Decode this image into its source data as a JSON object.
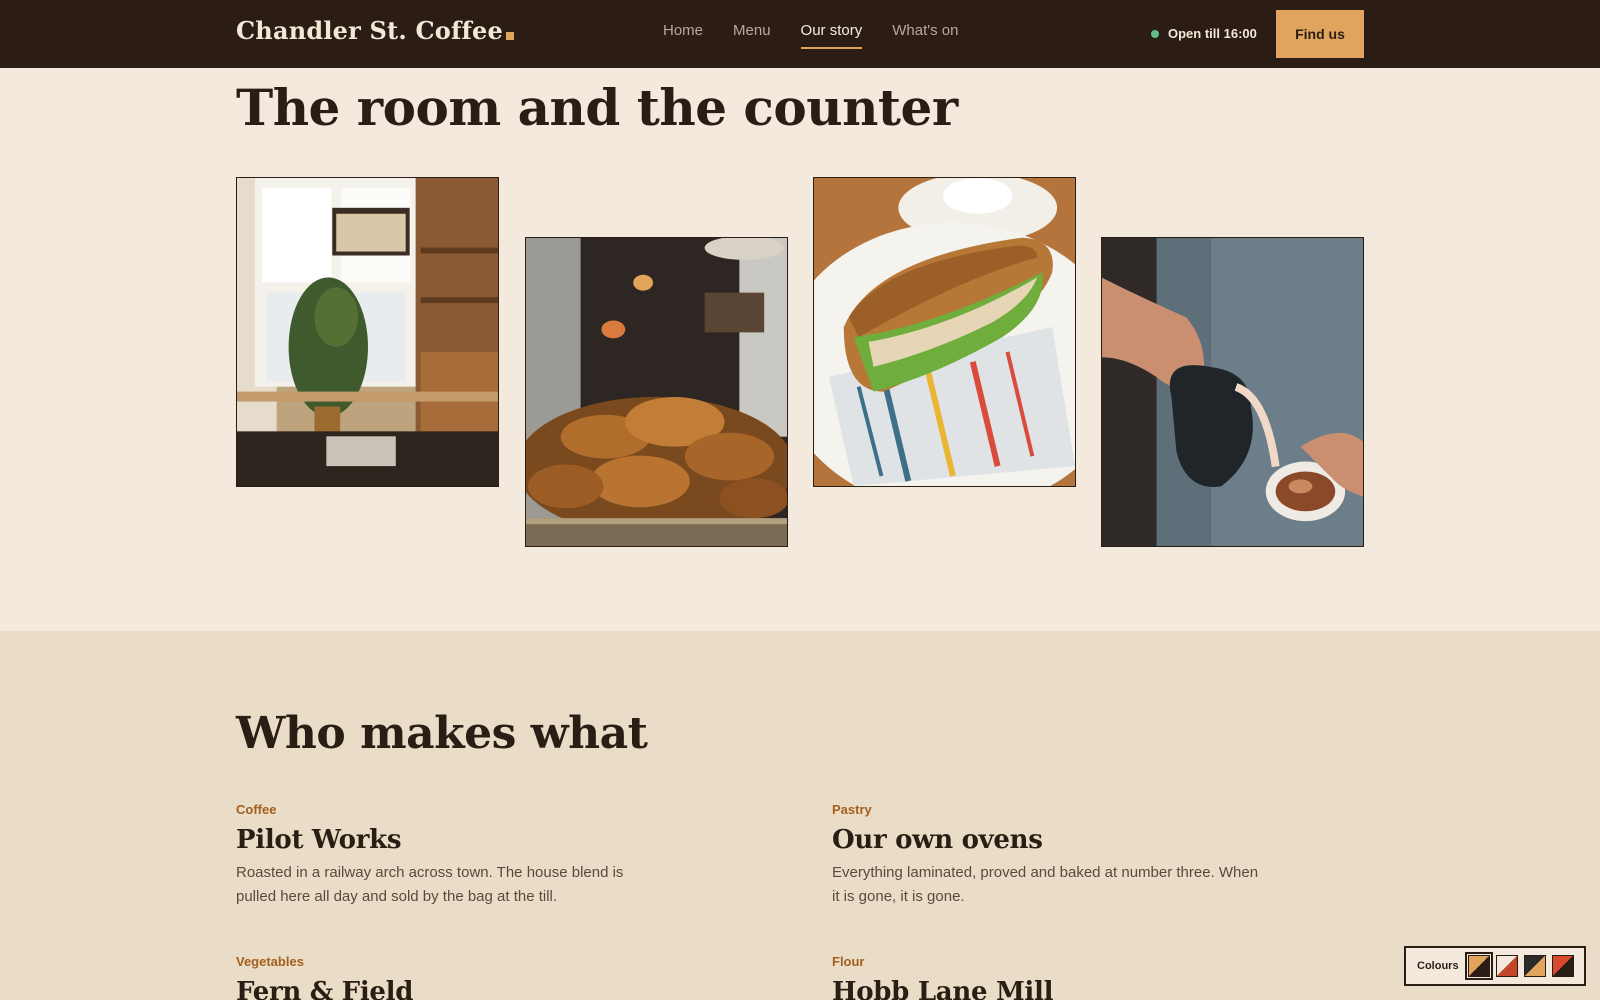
{
  "header": {
    "brand": "Chandler St. Coffee",
    "nav": [
      {
        "label": "Home",
        "active": false
      },
      {
        "label": "Menu",
        "active": false
      },
      {
        "label": "Our story",
        "active": true
      },
      {
        "label": "What's on",
        "active": false
      }
    ],
    "status": "Open till 16:00",
    "cta": "Find us"
  },
  "room": {
    "title": "The room and the counter",
    "photos": [
      "cafe-interior-photo",
      "croissants-photo",
      "baguette-sandwich-photo",
      "latte-pour-photo"
    ]
  },
  "makers": {
    "title": "Who makes what",
    "items": [
      {
        "category": "Coffee",
        "name": "Pilot Works",
        "description": "Roasted in a railway arch across town. The house blend is pulled here all day and sold by the bag at the till."
      },
      {
        "category": "Pastry",
        "name": "Our own ovens",
        "description": "Everything laminated, proved and baked at number three. When it is gone, it is gone."
      },
      {
        "category": "Vegetables",
        "name": "Fern & Field",
        "description": ""
      },
      {
        "category": "Flour",
        "name": "Hobb Lane Mill",
        "description": ""
      }
    ]
  },
  "colours": {
    "label": "Colours",
    "swatches": [
      {
        "name": "warm-swatch",
        "a": "#e0a45c",
        "b": "#2b1d15",
        "selected": true
      },
      {
        "name": "cream-red-swatch",
        "a": "#f3e9dc",
        "b": "#c4472b",
        "selected": false
      },
      {
        "name": "dark-gold-swatch",
        "a": "#2b2b2b",
        "b": "#e0a45c",
        "selected": false
      },
      {
        "name": "red-dark-swatch",
        "a": "#d84a2b",
        "b": "#2b1d15",
        "selected": false
      }
    ]
  },
  "colors": {
    "header_bg": "#2b1d15",
    "accent": "#e0a45c",
    "page_bg": "#f3e9dc",
    "section_bg": "#eaddc7",
    "category": "#a35f1e",
    "status_dot": "#5fbf86"
  }
}
